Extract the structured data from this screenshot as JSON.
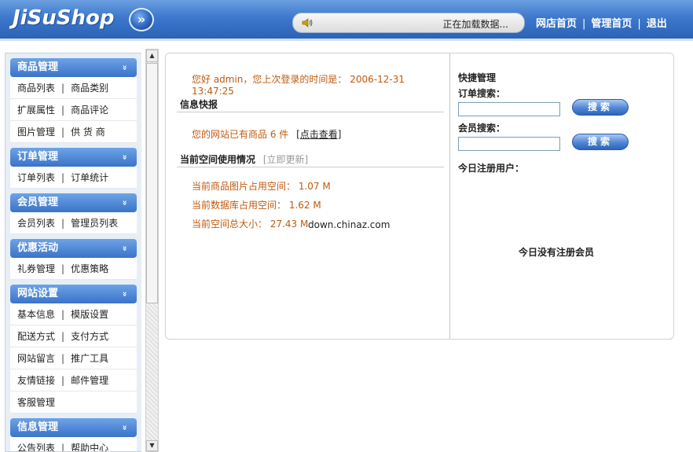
{
  "header": {
    "logo": "JiSuShop",
    "toggle_icon": "double-chevron-right-icon",
    "status_text": "正在加载数据...",
    "nav": {
      "shop_home": "网店首页",
      "admin_home": "管理首页",
      "logout": "退出",
      "separator": "|"
    }
  },
  "sidebar": {
    "separator": "|",
    "groups": [
      {
        "title": "商品管理",
        "rows": [
          [
            "商品列表",
            "商品类别"
          ],
          [
            "扩展属性",
            "商品评论"
          ],
          [
            "图片管理",
            "供 货 商"
          ]
        ]
      },
      {
        "title": "订单管理",
        "rows": [
          [
            "订单列表",
            "订单统计"
          ]
        ]
      },
      {
        "title": "会员管理",
        "rows": [
          [
            "会员列表",
            "管理员列表"
          ]
        ]
      },
      {
        "title": "优惠活动",
        "rows": [
          [
            "礼券管理",
            "优惠策略"
          ]
        ]
      },
      {
        "title": "网站设置",
        "rows": [
          [
            "基本信息",
            "模版设置"
          ],
          [
            "配送方式",
            "支付方式"
          ],
          [
            "网站留言",
            "推广工具"
          ],
          [
            "友情链接",
            "邮件管理"
          ],
          [
            "客服管理"
          ]
        ]
      },
      {
        "title": "信息管理",
        "rows": [
          [
            "公告列表",
            "帮助中心"
          ]
        ]
      }
    ]
  },
  "main": {
    "greeting": "您好 admin，您上次登录的时间是： 2006-12-31 13:47:25",
    "info_title": "信息快报",
    "product_count_text": "您的网站已有商品 6 件",
    "view_link": "[点击查看]",
    "space_title": "当前空间使用情况",
    "update_link": "[立即更新]",
    "image_space": "当前商品图片占用空间： 1.07 M",
    "db_space": "当前数据库占用空间： 1.62 M",
    "total_space": "当前空间总大小： 27.43 M",
    "watermark": "down.chinaz.com"
  },
  "quick": {
    "title": "快捷管理",
    "order_label": "订单搜索：",
    "member_label": "会员搜索：",
    "search_button": "搜索",
    "today_users_label": "今日注册用户：",
    "no_users": "今日没有注册会员"
  },
  "colors": {
    "header_blue": "#3d78cc",
    "orange_text": "#c05a10",
    "update_gray": "#999999"
  }
}
